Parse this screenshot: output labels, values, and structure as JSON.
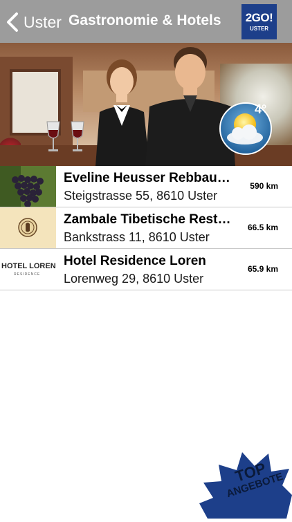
{
  "header": {
    "back_label": "Uster",
    "title": "Gastronomie & Hotels",
    "logo_main": "2GO!",
    "logo_sub": "USTER"
  },
  "weather": {
    "temperature": "4°",
    "icon": "sun-behind-cloud-icon"
  },
  "listings": [
    {
      "name": "Eveline Heusser Rebbau…",
      "address": "Steigstrasse  55, 8610 Uster",
      "distance": "590 km",
      "thumb": "grapes-photo"
    },
    {
      "name": "Zambale Tibetische Rest…",
      "address": "Bankstrass  11, 8610 Uster",
      "distance": "66.5 km",
      "thumb": "tibetan-emblem"
    },
    {
      "name": "Hotel Residence Loren",
      "address": "Lorenweg  29, 8610 Uster",
      "distance": "65.9 km",
      "thumb": "hotel-loren-logo"
    }
  ],
  "thumb_logo_text": {
    "hotel_loren": "HOTEL LOREN",
    "hotel_loren_sub": "RESIDENCE"
  },
  "top_badge": {
    "line1": "TOP",
    "line2": "ANGEBOTE"
  },
  "colors": {
    "header_bg": "#9c9c9c",
    "logo_bg": "#1d3f8a",
    "badge_bg": "#1d3f8a",
    "badge_text": "#0a1a3a"
  }
}
